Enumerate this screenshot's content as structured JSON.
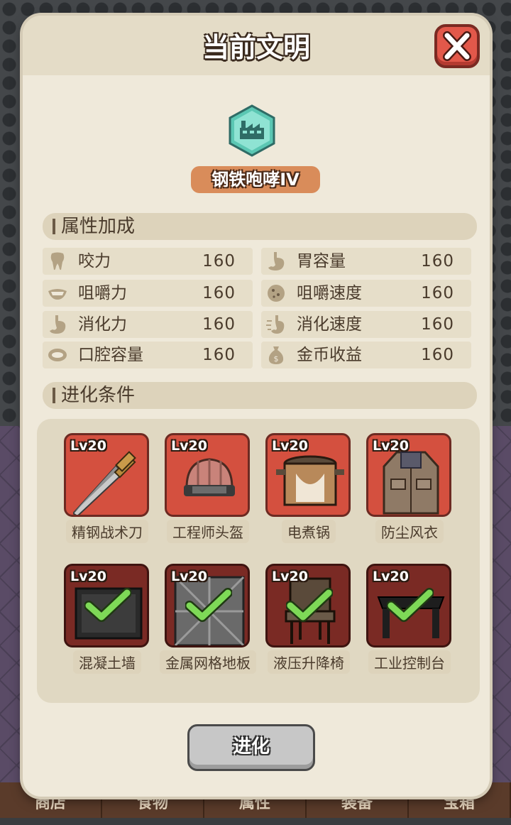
{
  "bottom_tabs": [
    "商店",
    "食物",
    "属性",
    "装备",
    "宝箱"
  ],
  "panel": {
    "title": "当前文明",
    "civilization_name": "钢铁咆哮IV",
    "civilization_icon": "factory-icon"
  },
  "attributes": {
    "header": "属性加成",
    "items": [
      {
        "icon": "tooth-icon",
        "name": "咬力",
        "value": "160"
      },
      {
        "icon": "stomach-icon",
        "name": "胃容量",
        "value": "160"
      },
      {
        "icon": "teeth-smile-icon",
        "name": "咀嚼力",
        "value": "160"
      },
      {
        "icon": "cookie-icon",
        "name": "咀嚼速度",
        "value": "160"
      },
      {
        "icon": "stomach-icon",
        "name": "消化力",
        "value": "160"
      },
      {
        "icon": "stomach-speed-icon",
        "name": "消化速度",
        "value": "160"
      },
      {
        "icon": "mouth-icon",
        "name": "口腔容量",
        "value": "160"
      },
      {
        "icon": "money-bag-icon",
        "name": "金币收益",
        "value": "160"
      }
    ]
  },
  "conditions": {
    "header": "进化条件",
    "items": [
      {
        "level": "Lv20",
        "name": "精钢战术刀",
        "completed": false,
        "icon": "dagger-icon"
      },
      {
        "level": "Lv20",
        "name": "工程师头盔",
        "completed": false,
        "icon": "helmet-icon"
      },
      {
        "level": "Lv20",
        "name": "电煮锅",
        "completed": false,
        "icon": "pot-icon"
      },
      {
        "level": "Lv20",
        "name": "防尘风衣",
        "completed": false,
        "icon": "coat-icon"
      },
      {
        "level": "Lv20",
        "name": "混凝土墙",
        "completed": true,
        "icon": "wall-icon"
      },
      {
        "level": "Lv20",
        "name": "金属网格地板",
        "completed": true,
        "icon": "floor-icon"
      },
      {
        "level": "Lv20",
        "name": "液压升降椅",
        "completed": true,
        "icon": "chair-icon"
      },
      {
        "level": "Lv20",
        "name": "工业控制台",
        "completed": true,
        "icon": "desk-icon"
      }
    ]
  },
  "evolve_button": "进化",
  "colors": {
    "close_button": "#e2584a",
    "tile_pending": "#d4503f",
    "tile_done": "#7a2a24",
    "check": "#7ed957",
    "badge": "#d98c5a"
  }
}
